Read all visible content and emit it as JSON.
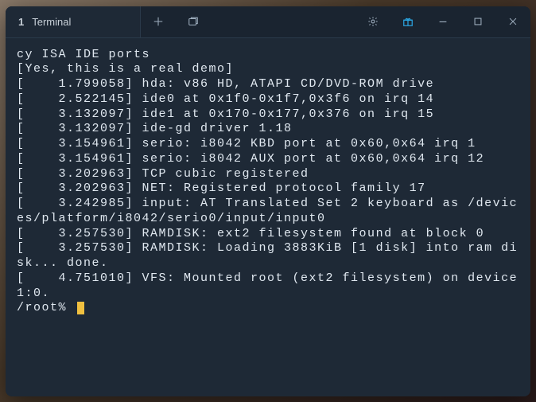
{
  "tab": {
    "index": "1",
    "title": "Terminal"
  },
  "terminal": {
    "lines": [
      "cy ISA IDE ports",
      "[Yes, this is a real demo]",
      "[    1.799058] hda: v86 HD, ATAPI CD/DVD-ROM drive",
      "[    2.522145] ide0 at 0x1f0-0x1f7,0x3f6 on irq 14",
      "[    3.132097] ide1 at 0x170-0x177,0x376 on irq 15",
      "[    3.132097] ide-gd driver 1.18",
      "[    3.154961] serio: i8042 KBD port at 0x60,0x64 irq 1",
      "[    3.154961] serio: i8042 AUX port at 0x60,0x64 irq 12",
      "[    3.202963] TCP cubic registered",
      "[    3.202963] NET: Registered protocol family 17",
      "[    3.242985] input: AT Translated Set 2 keyboard as /devices/platform/i8042/serio0/input/input0",
      "[    3.257530] RAMDISK: ext2 filesystem found at block 0",
      "[    3.257530] RAMDISK: Loading 3883KiB [1 disk] into ram disk... done.",
      "[    4.751010] VFS: Mounted root (ext2 filesystem) on device 1:0."
    ],
    "prompt": "/root% "
  }
}
